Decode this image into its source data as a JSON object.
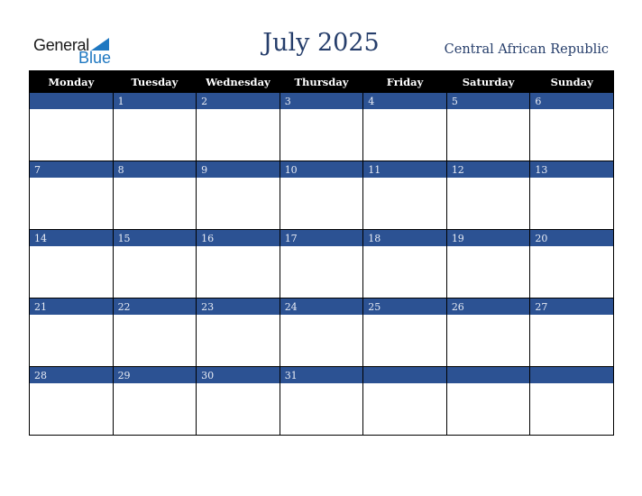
{
  "logo": {
    "line1": "General",
    "line2": "Blue"
  },
  "header": {
    "title": "July 2025",
    "country": "Central African Republic"
  },
  "weekdays": [
    "Monday",
    "Tuesday",
    "Wednesday",
    "Thursday",
    "Friday",
    "Saturday",
    "Sunday"
  ],
  "weeks": [
    [
      "",
      "1",
      "2",
      "3",
      "4",
      "5",
      "6"
    ],
    [
      "7",
      "8",
      "9",
      "10",
      "11",
      "12",
      "13"
    ],
    [
      "14",
      "15",
      "16",
      "17",
      "18",
      "19",
      "20"
    ],
    [
      "21",
      "22",
      "23",
      "24",
      "25",
      "26",
      "27"
    ],
    [
      "28",
      "29",
      "30",
      "31",
      "",
      "",
      ""
    ]
  ],
  "colors": {
    "band": "#2c5293",
    "header_bg": "#000000",
    "title": "#263e6b",
    "logo_blue": "#1f78c1"
  }
}
